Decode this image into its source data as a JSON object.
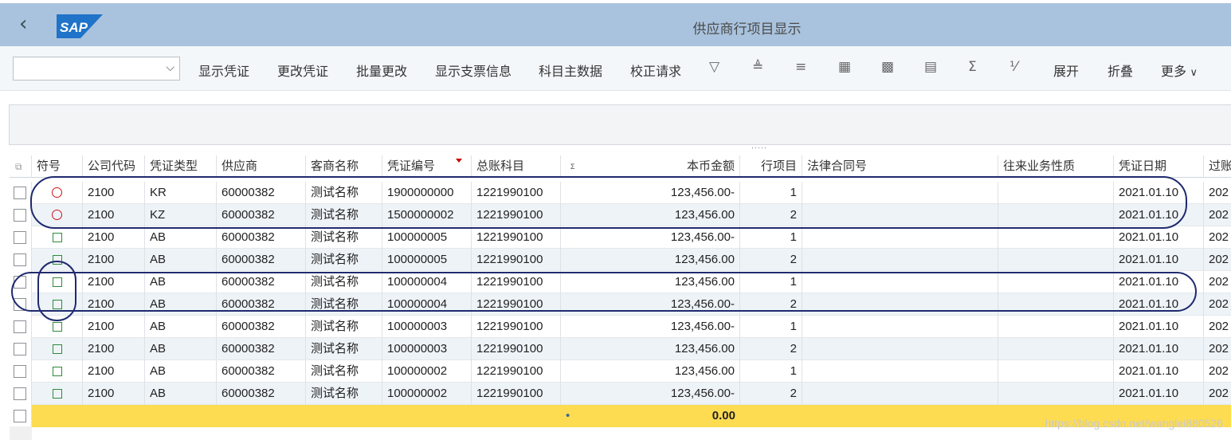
{
  "header": {
    "title": "供应商行项目显示",
    "logo_text": "SAP"
  },
  "toolbar": {
    "select_value": "",
    "buttons": [
      "显示凭证",
      "更改凭证",
      "批量更改",
      "显示支票信息",
      "科目主数据",
      "校正请求"
    ],
    "expand": "展开",
    "collapse": "折叠",
    "more": "更多"
  },
  "table": {
    "columns": [
      "符号",
      "公司代码",
      "凭证类型",
      "供应商",
      "客商名称",
      "凭证编号",
      "总账科目",
      "本币金额",
      "行项目",
      "法律合同号",
      "往来业务性质",
      "凭证日期",
      "过账"
    ],
    "rows": [
      {
        "symbol": "circle-red",
        "company": "2100",
        "doctype": "KR",
        "vendor": "60000382",
        "name": "测试名称",
        "docno": "1900000000",
        "gl": "1221990100",
        "amount": "123,456.00-",
        "item": "1",
        "contract": "",
        "nature": "",
        "date": "2021.01.10",
        "post": "202"
      },
      {
        "symbol": "circle-red",
        "company": "2100",
        "doctype": "KZ",
        "vendor": "60000382",
        "name": "测试名称",
        "docno": "1500000002",
        "gl": "1221990100",
        "amount": "123,456.00",
        "item": "2",
        "contract": "",
        "nature": "",
        "date": "2021.01.10",
        "post": "202"
      },
      {
        "symbol": "square-green",
        "company": "2100",
        "doctype": "AB",
        "vendor": "60000382",
        "name": "测试名称",
        "docno": "100000005",
        "gl": "1221990100",
        "amount": "123,456.00-",
        "item": "1",
        "contract": "",
        "nature": "",
        "date": "2021.01.10",
        "post": "202"
      },
      {
        "symbol": "square-green",
        "company": "2100",
        "doctype": "AB",
        "vendor": "60000382",
        "name": "测试名称",
        "docno": "100000005",
        "gl": "1221990100",
        "amount": "123,456.00",
        "item": "2",
        "contract": "",
        "nature": "",
        "date": "2021.01.10",
        "post": "202"
      },
      {
        "symbol": "square-green",
        "company": "2100",
        "doctype": "AB",
        "vendor": "60000382",
        "name": "测试名称",
        "docno": "100000004",
        "gl": "1221990100",
        "amount": "123,456.00",
        "item": "1",
        "contract": "",
        "nature": "",
        "date": "2021.01.10",
        "post": "202"
      },
      {
        "symbol": "square-green",
        "company": "2100",
        "doctype": "AB",
        "vendor": "60000382",
        "name": "测试名称",
        "docno": "100000004",
        "gl": "1221990100",
        "amount": "123,456.00-",
        "item": "2",
        "contract": "",
        "nature": "",
        "date": "2021.01.10",
        "post": "202"
      },
      {
        "symbol": "square-green",
        "company": "2100",
        "doctype": "AB",
        "vendor": "60000382",
        "name": "测试名称",
        "docno": "100000003",
        "gl": "1221990100",
        "amount": "123,456.00-",
        "item": "1",
        "contract": "",
        "nature": "",
        "date": "2021.01.10",
        "post": "202"
      },
      {
        "symbol": "square-green",
        "company": "2100",
        "doctype": "AB",
        "vendor": "60000382",
        "name": "测试名称",
        "docno": "100000003",
        "gl": "1221990100",
        "amount": "123,456.00",
        "item": "2",
        "contract": "",
        "nature": "",
        "date": "2021.01.10",
        "post": "202"
      },
      {
        "symbol": "square-green",
        "company": "2100",
        "doctype": "AB",
        "vendor": "60000382",
        "name": "测试名称",
        "docno": "100000002",
        "gl": "1221990100",
        "amount": "123,456.00",
        "item": "1",
        "contract": "",
        "nature": "",
        "date": "2021.01.10",
        "post": "202"
      },
      {
        "symbol": "square-green",
        "company": "2100",
        "doctype": "AB",
        "vendor": "60000382",
        "name": "测试名称",
        "docno": "100000002",
        "gl": "1221990100",
        "amount": "123,456.00-",
        "item": "2",
        "contract": "",
        "nature": "",
        "date": "2021.01.10",
        "post": "202"
      }
    ],
    "total": {
      "bullet": "•",
      "amount": "0.00"
    }
  },
  "watermark": "https://blog.csdn.net/wanglei880526",
  "colors": {
    "shell": "#a9c3de",
    "total_row": "#fddc52",
    "stripe": "#eef3f8",
    "annotation": "#1f2a6e"
  }
}
